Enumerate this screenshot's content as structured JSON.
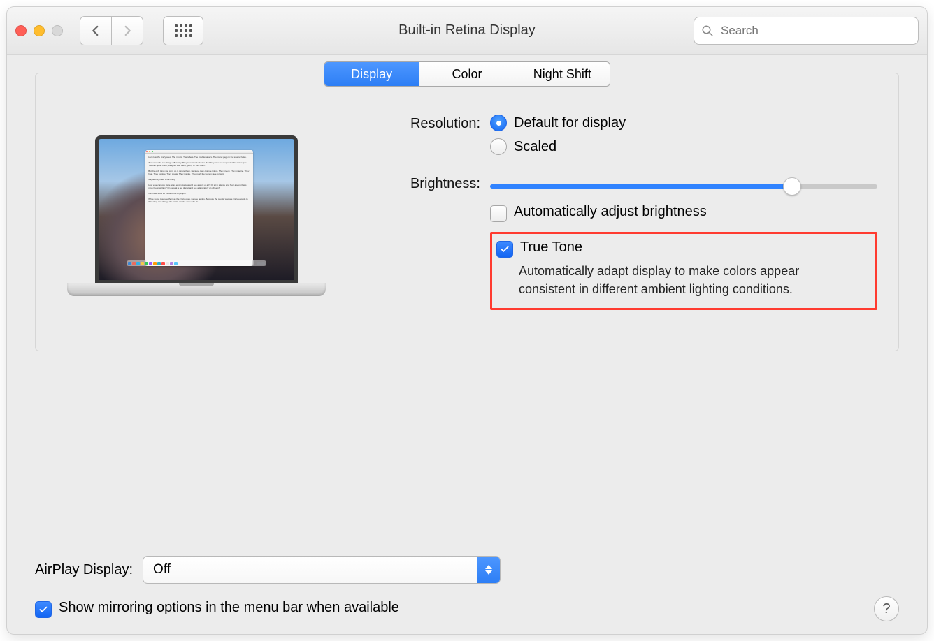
{
  "window": {
    "title": "Built-in Retina Display"
  },
  "search": {
    "placeholder": "Search"
  },
  "tabs": {
    "display": "Display",
    "color": "Color",
    "night_shift": "Night Shift",
    "active": "display"
  },
  "settings": {
    "resolution_label": "Resolution:",
    "radio_default": "Default for display",
    "radio_scaled": "Scaled",
    "brightness_label": "Brightness:",
    "brightness_value_pct": 78,
    "auto_brightness_label": "Automatically adjust brightness",
    "auto_brightness_checked": false,
    "truetone_label": "True Tone",
    "truetone_checked": true,
    "truetone_desc": "Automatically adapt display to make colors appear consistent in different ambient lighting conditions."
  },
  "airplay": {
    "label": "AirPlay Display:",
    "value": "Off",
    "mirror_label": "Show mirroring options in the menu bar when available",
    "mirror_checked": true
  },
  "help": {
    "symbol": "?"
  }
}
